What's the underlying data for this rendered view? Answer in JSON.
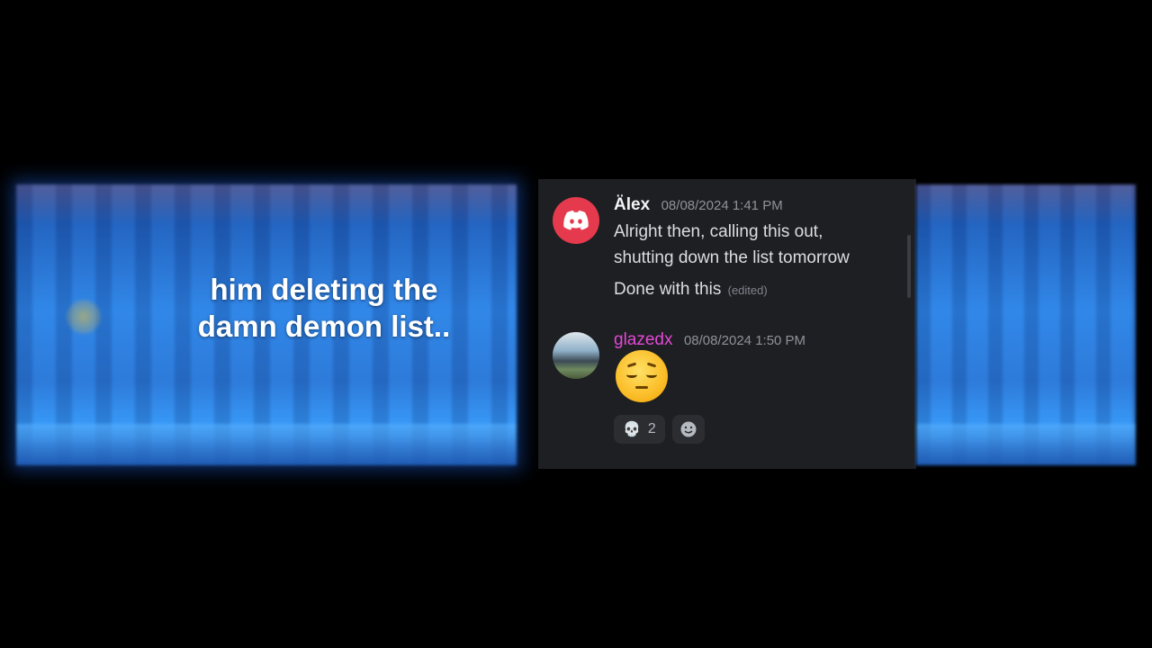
{
  "caption": {
    "line1": "him deleting the",
    "line2": "damn demon list.."
  },
  "messages": [
    {
      "author": "Älex",
      "timestamp": "08/08/2024 1:41 PM",
      "avatar_icon": "discord-logo-icon",
      "avatar_color": "#e53a4d",
      "lines": [
        "Alright then, calling this out,",
        "shutting down the list tomorrow"
      ],
      "followup": "Done with this",
      "followup_edited": "(edited)"
    },
    {
      "author": "glazedx",
      "author_color": "#e348d8",
      "timestamp": "08/08/2024 1:50 PM",
      "avatar_icon": "profile-photo",
      "content_emoji": "pensive-face-emoji",
      "reactions": [
        {
          "emoji": "skull-emoji",
          "glyph": "💀",
          "count": "2"
        }
      ],
      "add_reaction_icon": "add-reaction-icon"
    }
  ]
}
